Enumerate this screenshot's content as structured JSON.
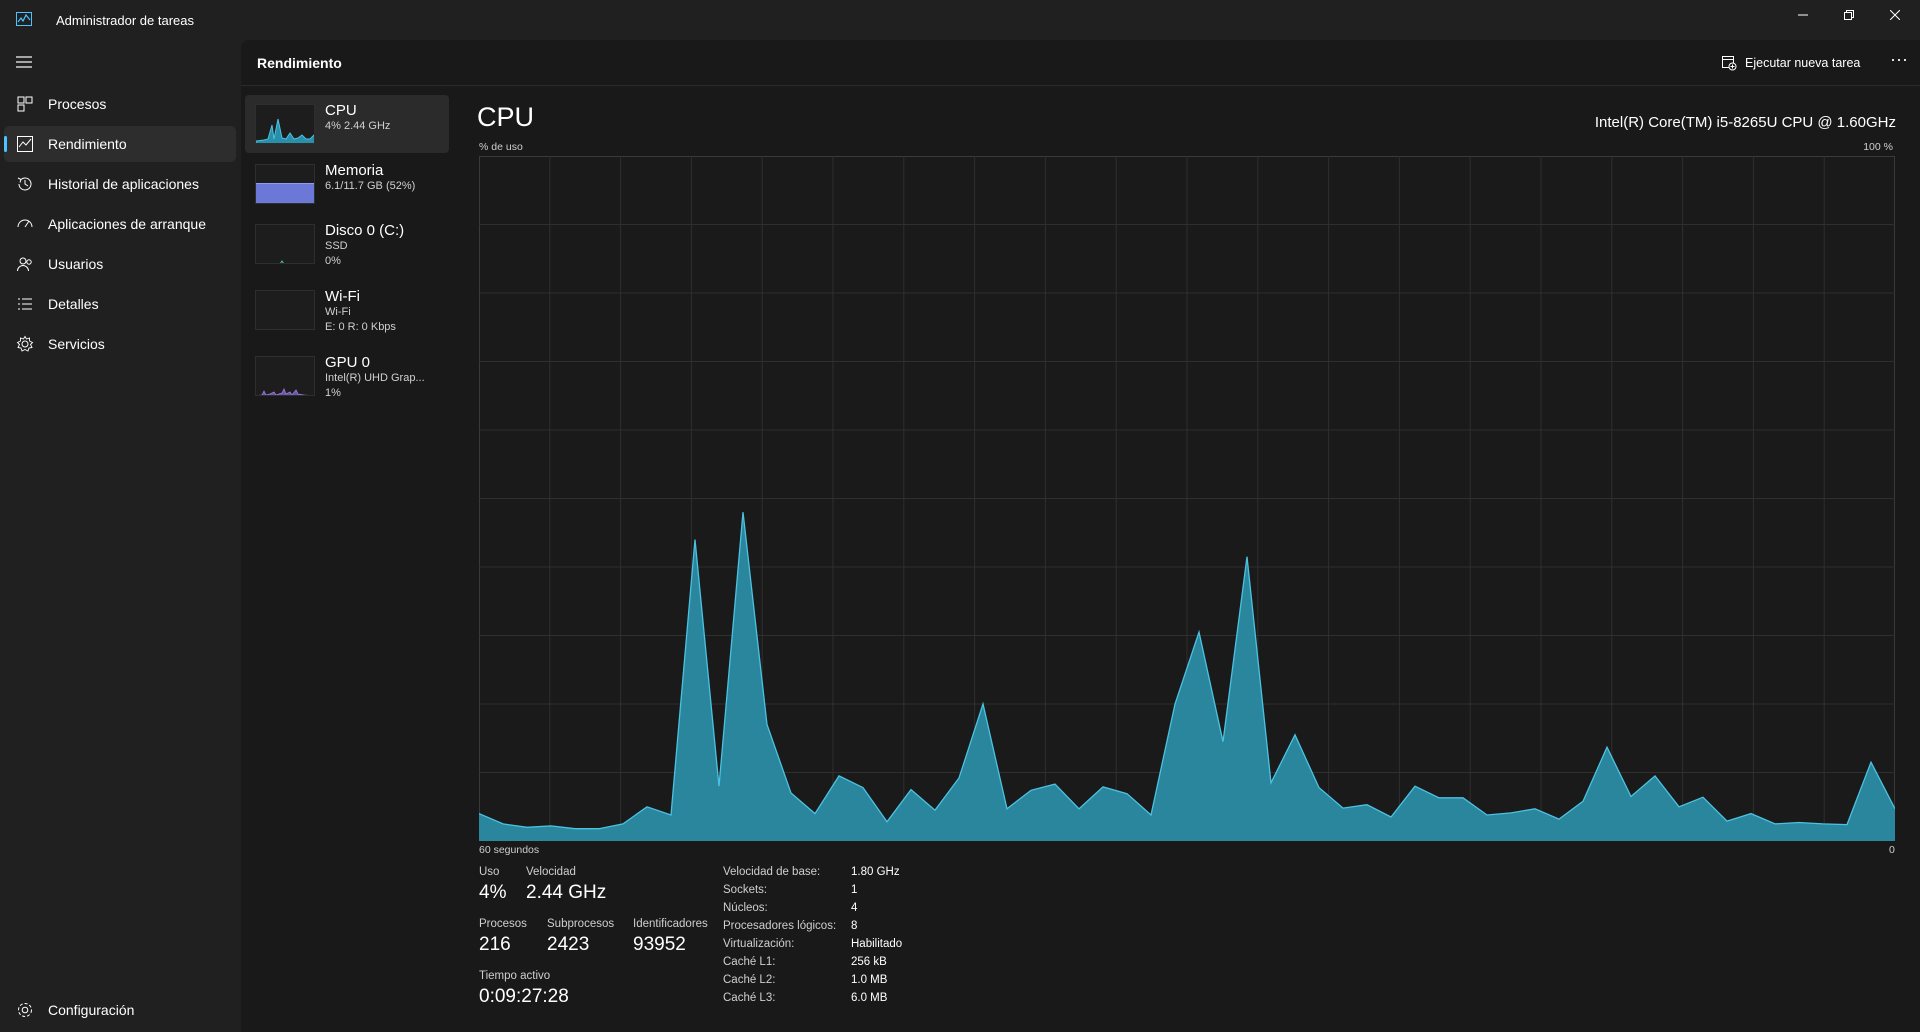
{
  "window": {
    "title": "Administrador de tareas"
  },
  "sidebar": {
    "items": [
      {
        "label": "Procesos",
        "icon": "processes-icon"
      },
      {
        "label": "Rendimiento",
        "icon": "performance-icon",
        "active": true
      },
      {
        "label": "Historial de aplicaciones",
        "icon": "history-icon"
      },
      {
        "label": "Aplicaciones de arranque",
        "icon": "startup-icon"
      },
      {
        "label": "Usuarios",
        "icon": "users-icon"
      },
      {
        "label": "Detalles",
        "icon": "details-icon"
      },
      {
        "label": "Servicios",
        "icon": "services-icon"
      }
    ],
    "settings_label": "Configuración"
  },
  "header": {
    "title": "Rendimiento",
    "run_task_label": "Ejecutar nueva tarea",
    "more_label": "···"
  },
  "perf_list": [
    {
      "name": "CPU",
      "lines": [
        "4% 2.44 GHz"
      ],
      "color": "#4cc2e2"
    },
    {
      "name": "Memoria",
      "lines": [
        "6.1/11.7 GB (52%)"
      ],
      "color": "#7b8ae0"
    },
    {
      "name": "Disco 0 (C:)",
      "lines": [
        "SSD",
        "0%"
      ],
      "color": "#4fbf9a"
    },
    {
      "name": "Wi-Fi",
      "lines": [
        "Wi-Fi",
        "E: 0 R: 0 Kbps"
      ],
      "color": "#c46ba7"
    },
    {
      "name": "GPU 0",
      "lines": [
        "Intel(R) UHD Grap...",
        "1%"
      ],
      "color": "#9b7be0"
    }
  ],
  "cpu": {
    "title": "CPU",
    "model": "Intel(R) Core(TM) i5-8265U CPU @ 1.60GHz",
    "y_label": "% de uso",
    "y_max_label": "100 %",
    "x_left_label": "60 segundos",
    "x_right_label": "0",
    "stats": {
      "uso_label": "Uso",
      "uso": "4%",
      "velocidad_label": "Velocidad",
      "velocidad": "2.44 GHz",
      "procesos_label": "Procesos",
      "procesos": "216",
      "subprocesos_label": "Subprocesos",
      "subprocesos": "2423",
      "identificadores_label": "Identificadores",
      "identificadores": "93952",
      "tiempo_label": "Tiempo activo",
      "tiempo": "0:09:27:28"
    },
    "specs": [
      {
        "key": "Velocidad de base:",
        "value": "1.80 GHz"
      },
      {
        "key": "Sockets:",
        "value": "1"
      },
      {
        "key": "Núcleos:",
        "value": "4"
      },
      {
        "key": "Procesadores lógicos:",
        "value": "8"
      },
      {
        "key": "Virtualización:",
        "value": "Habilitado"
      },
      {
        "key": "Caché L1:",
        "value": "256 kB"
      },
      {
        "key": "Caché L2:",
        "value": "1.0 MB"
      },
      {
        "key": "Caché L3:",
        "value": "6.0 MB"
      }
    ]
  },
  "colors": {
    "accent": "#4cc2ff",
    "cpu_line": "#4cc2e2",
    "cpu_fill": "#2a8fa8"
  },
  "chart_data": {
    "type": "area",
    "ylabel": "% de uso",
    "ylim": [
      0,
      100
    ],
    "x_range": [
      "60 segundos",
      "0"
    ],
    "values": [
      4,
      2.5,
      2,
      2.2,
      1.8,
      1.8,
      2.5,
      5,
      3.8,
      44,
      8,
      48,
      17,
      7,
      4,
      9.5,
      7.8,
      2.8,
      7.5,
      4.5,
      9.2,
      20,
      4.7,
      7.4,
      8.3,
      4.7,
      7.9,
      6.9,
      3.8,
      20,
      30.5,
      14.5,
      41.5,
      8.5,
      15.5,
      7.8,
      4.8,
      5.3,
      3.5,
      8,
      6.3,
      6.3,
      3.8,
      4.1,
      4.7,
      3.2,
      5.8,
      13.7,
      6.5,
      9.5,
      5,
      6.4,
      2.9,
      4,
      2.5,
      2.7,
      2.5,
      2.4,
      11.5,
      4.7
    ]
  }
}
